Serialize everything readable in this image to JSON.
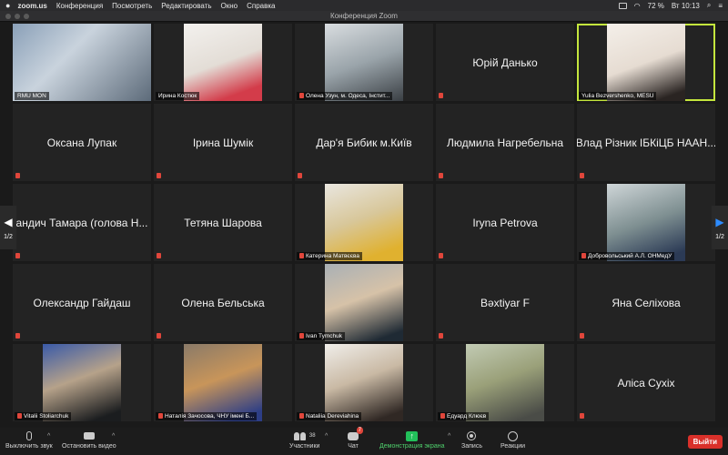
{
  "menubar": {
    "app": "zoom.us",
    "menus": [
      "Конференция",
      "Посмотреть",
      "Редактировать",
      "Окно",
      "Справка"
    ],
    "battery": "72 %",
    "clock": "Вт 10:13"
  },
  "window": {
    "title": "Конференция Zoom"
  },
  "pager": {
    "left_label": "1/2",
    "right_label": "1/2"
  },
  "tiles": [
    {
      "label": "RMU MON",
      "muted": false,
      "video": true
    },
    {
      "label": "Ирина Костюк",
      "muted": false,
      "video": true
    },
    {
      "label": "Олена Узун, м. Одеса,  Інстит...",
      "muted": true,
      "video": true
    },
    {
      "name": "Юрій Данько",
      "muted": true,
      "video": false
    },
    {
      "label": "Yulia Bezvershenko, MESU",
      "muted": false,
      "video": true,
      "active": true
    },
    {
      "name": "Оксана Лупак",
      "muted": true,
      "video": false
    },
    {
      "name": "Ірина Шумік",
      "muted": true,
      "video": false
    },
    {
      "name": "Дар'я Бибик м.Київ",
      "muted": true,
      "video": false
    },
    {
      "name": "Людмила Нагребельна",
      "muted": true,
      "video": false
    },
    {
      "name": "Влад Різник ІБКіЦБ НААН...",
      "muted": true,
      "video": false
    },
    {
      "name": "андич Тамара (голова Н...",
      "muted": true,
      "video": false
    },
    {
      "name": "Тетяна Шарова",
      "muted": true,
      "video": false
    },
    {
      "label": "Катерина Матвєєва",
      "muted": true,
      "video": true
    },
    {
      "name": "Iryna Petrova",
      "muted": true,
      "video": false
    },
    {
      "label": "Добровольський А.Л. ОНМедУ",
      "muted": true,
      "video": true
    },
    {
      "name": "Олександр Гайдаш",
      "muted": true,
      "video": false
    },
    {
      "name": "Олена Бельська",
      "muted": true,
      "video": false
    },
    {
      "label": "Ivan Tymchuk",
      "muted": true,
      "video": true
    },
    {
      "name": "Bəxtiyar F",
      "muted": true,
      "video": false
    },
    {
      "name": "Яна Селіхова",
      "muted": true,
      "video": false
    },
    {
      "label": "Vitalii Stoliarchuk",
      "muted": true,
      "video": true
    },
    {
      "label": "Наталія Зачосова, ЧНУ імені Б...",
      "muted": true,
      "video": true
    },
    {
      "label": "Nataliia Dereviahina",
      "muted": true,
      "video": true
    },
    {
      "label": "Едуард Клюєв",
      "muted": true,
      "video": true
    },
    {
      "name": "Аліса Сухіх",
      "muted": true,
      "video": false
    }
  ],
  "toolbar": {
    "mute_label": "Выключить звук",
    "video_label": "Остановить видео",
    "participants_label": "Участники",
    "participants_count": "38",
    "chat_label": "Чат",
    "chat_badge": "7",
    "share_label": "Демонстрация экрана",
    "record_label": "Запись",
    "reactions_label": "Реакции",
    "leave_label": "Выйти"
  },
  "colors": {
    "active_speaker": "#c4e63d",
    "leave": "#d9302a",
    "share": "#22c05a",
    "muted_icon": "#e0463b"
  }
}
